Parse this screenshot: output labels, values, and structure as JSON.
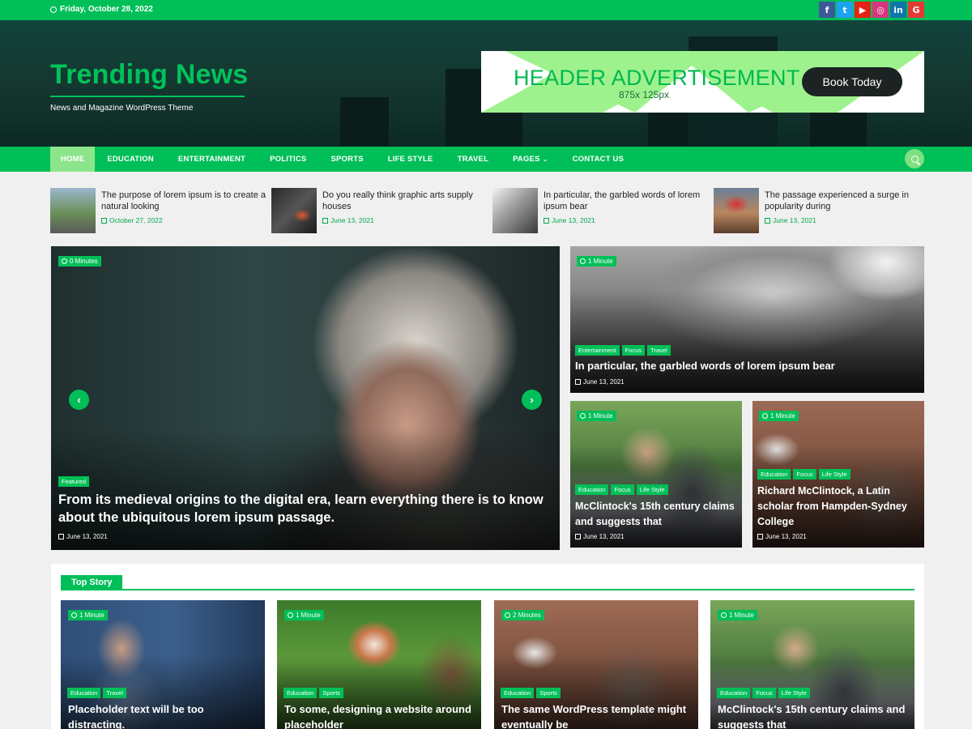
{
  "topbar": {
    "date": "Friday, October 28, 2022",
    "socials": [
      {
        "icon": "facebook-icon",
        "glyph": "f",
        "color": "#3b5998"
      },
      {
        "icon": "twitter-icon",
        "glyph": "t",
        "color": "#1da1f2"
      },
      {
        "icon": "youtube-icon",
        "glyph": "▶",
        "color": "#e62117"
      },
      {
        "icon": "instagram-icon",
        "glyph": "◎",
        "color": "#d6367f"
      },
      {
        "icon": "linkedin-icon",
        "glyph": "in",
        "color": "#0e76a8"
      },
      {
        "icon": "google-icon",
        "glyph": "G",
        "color": "#e53935"
      }
    ]
  },
  "header": {
    "site_title": "Trending News",
    "tagline": "News and Magazine WordPress Theme",
    "ad": {
      "title": "HEADER ADVERTISEMENT",
      "size": "875x 125px",
      "button": "Book Today"
    }
  },
  "nav": {
    "items": [
      "HOME",
      "EDUCATION",
      "ENTERTAINMENT",
      "POLITICS",
      "SPORTS",
      "LIFE STYLE",
      "TRAVEL",
      "PAGES",
      "CONTACT US"
    ],
    "active": "HOME"
  },
  "ticker": [
    {
      "title": "The purpose of lorem ipsum is to create a natural looking",
      "date": "October 27, 2022"
    },
    {
      "title": "Do you really think graphic arts supply houses",
      "date": "June 13, 2021"
    },
    {
      "title": "In particular, the garbled words of lorem ipsum bear",
      "date": "June 13, 2021"
    },
    {
      "title": "The passage experienced a surge in popularity during",
      "date": "June 13, 2021"
    }
  ],
  "hero": {
    "read_time": "0 Minutes",
    "tag": "Featured",
    "title": "From its medieval origins to the digital era, learn everything there is to know about the ubiquitous lorem ipsum passage.",
    "date": "June 13, 2021",
    "prev": "‹",
    "next": "›"
  },
  "side_big": {
    "read_time": "1 Minute",
    "tags": [
      "Entertainment",
      "Focus",
      "Travel"
    ],
    "title": "In particular, the garbled words of lorem ipsum bear",
    "date": "June 13, 2021"
  },
  "side_small": [
    {
      "read_time": "1 Minute",
      "tags": [
        "Education",
        "Focus",
        "Life Style"
      ],
      "title": "McClintock's 15th century claims and suggests that",
      "date": "June 13, 2021"
    },
    {
      "read_time": "1 Minute",
      "tags": [
        "Education",
        "Focus",
        "Life Style"
      ],
      "title": "Richard McClintock, a Latin scholar from Hampden-Sydney College",
      "date": "June 13, 2021"
    }
  ],
  "top_story": {
    "heading": "Top Story",
    "cards": [
      {
        "read_time": "1 Minute",
        "tags": [
          "Education",
          "Travel"
        ],
        "title": "Placeholder text will be too distracting."
      },
      {
        "read_time": "1 Minute",
        "tags": [
          "Education",
          "Sports"
        ],
        "title": "To some, designing a website around placeholder"
      },
      {
        "read_time": "2 Minutes",
        "tags": [
          "Education",
          "Sports"
        ],
        "title": "The same WordPress template might eventually be"
      },
      {
        "read_time": "1 Minute",
        "tags": [
          "Education",
          "Focus",
          "Life Style"
        ],
        "title": "McClintock's 15th century claims and suggests that"
      }
    ]
  }
}
